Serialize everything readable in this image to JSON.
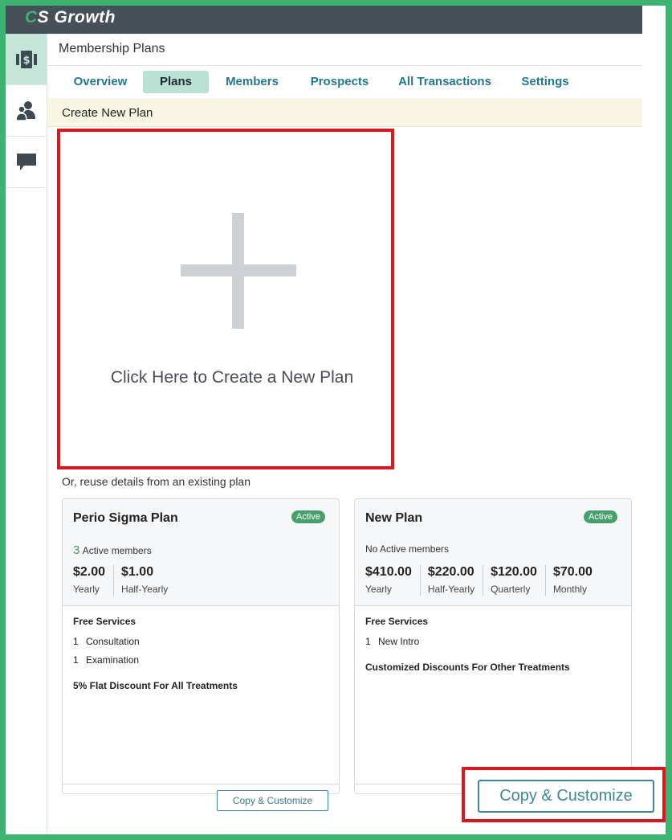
{
  "app": {
    "logo_c": "C",
    "logo_rest": "S Growth"
  },
  "sidebar": {
    "items": [
      {
        "icon": "money-icon",
        "active": true
      },
      {
        "icon": "users-icon",
        "active": false
      },
      {
        "icon": "chat-icon",
        "active": false
      }
    ]
  },
  "page": {
    "title": "Membership Plans"
  },
  "tabs": [
    "Overview",
    "Plans",
    "Members",
    "Prospects",
    "All Transactions",
    "Settings"
  ],
  "active_tab": "Plans",
  "create": {
    "bar_label": "Create New Plan",
    "box_text": "Click Here to Create a New Plan",
    "reuse_text": "Or, reuse details from an existing plan"
  },
  "plans": [
    {
      "name": "Perio Sigma Plan",
      "status": "Active",
      "members_count": "3",
      "members_label": "Active members",
      "prices": [
        {
          "amount": "$2.00",
          "period": "Yearly"
        },
        {
          "amount": "$1.00",
          "period": "Half-Yearly"
        }
      ],
      "free_services_title": "Free Services",
      "services": [
        {
          "qty": "1",
          "name": "Consultation"
        },
        {
          "qty": "1",
          "name": "Examination"
        }
      ],
      "discount": "5% Flat Discount For All Treatments",
      "button": "Copy & Customize"
    },
    {
      "name": "New Plan",
      "status": "Active",
      "members_label": "No Active members",
      "prices": [
        {
          "amount": "$410.00",
          "period": "Yearly"
        },
        {
          "amount": "$220.00",
          "period": "Half-Yearly"
        },
        {
          "amount": "$120.00",
          "period": "Quarterly"
        },
        {
          "amount": "$70.00",
          "period": "Monthly"
        }
      ],
      "free_services_title": "Free Services",
      "services": [
        {
          "qty": "1",
          "name": "New Intro"
        }
      ],
      "discount": "Customized Discounts For Other Treatments",
      "button": "Copy & Customize"
    }
  ],
  "colors": {
    "accent": "#3cb371",
    "tab_text": "#22798a",
    "highlight": "#e0141e"
  }
}
